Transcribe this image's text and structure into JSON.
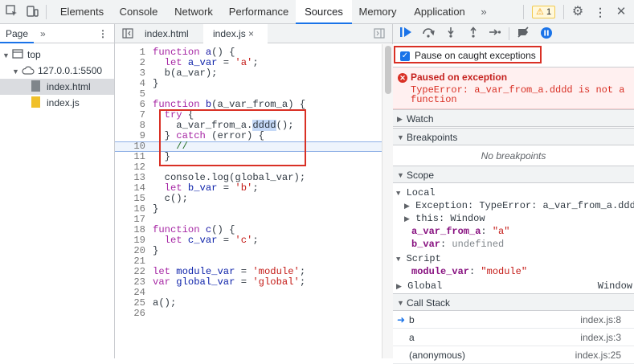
{
  "toolbar": {
    "tabs": [
      "Elements",
      "Console",
      "Network",
      "Performance",
      "Sources",
      "Memory",
      "Application"
    ],
    "more_tabs": "»",
    "warning_count": "1"
  },
  "navigator": {
    "tab": "Page",
    "more": "»",
    "tree": {
      "top": "top",
      "host": "127.0.0.1:5500",
      "files": [
        "index.html",
        "index.js"
      ]
    }
  },
  "editor": {
    "tabs": [
      "index.html",
      "index.js"
    ],
    "close": "×",
    "lines": [
      "1",
      "2",
      "3",
      "4",
      "5",
      "6",
      "7",
      "8",
      "9",
      "10",
      "11",
      "12",
      "13",
      "14",
      "15",
      "16",
      "17",
      "18",
      "19",
      "20",
      "21",
      "22",
      "23",
      "24",
      "25",
      "26"
    ],
    "code": {
      "l1a": "function ",
      "l1b": "a",
      "l1c": "() {",
      "l2a": "  let ",
      "l2b": "a_var",
      "l2c": " = ",
      "l2d": "'a'",
      "l2e": ";",
      "l3": "  b(a_var);",
      "l4": "}",
      "l6a": "function ",
      "l6b": "b",
      "l6c": "(a_var_from_a) {",
      "l7a": "  ",
      "l7b": "try",
      "l7c": " {",
      "l8a": "    a_var_from_a.",
      "l8b": "dddd",
      "l8c": "();",
      "l9a": "  } ",
      "l9b": "catch",
      "l9c": " (error) {",
      "l10": "    //",
      "l11": "  }",
      "l13": "  console.log(global_var);",
      "l14a": "  let ",
      "l14b": "b_var",
      "l14c": " = ",
      "l14d": "'b'",
      "l14e": ";",
      "l15": "  c();",
      "l16": "}",
      "l18a": "function ",
      "l18b": "c",
      "l18c": "() {",
      "l19a": "  let ",
      "l19b": "c_var",
      "l19c": " = ",
      "l19d": "'c'",
      "l19e": ";",
      "l20": "}",
      "l22a": "let ",
      "l22b": "module_var",
      "l22c": " = ",
      "l22d": "'module'",
      "l22e": ";",
      "l23a": "var ",
      "l23b": "global_var",
      "l23c": " = ",
      "l23d": "'global'",
      "l23e": ";",
      "l25": "a();"
    }
  },
  "debugger": {
    "pause_on_caught": "Pause on caught exceptions",
    "paused_title": "Paused on exception",
    "paused_message": "TypeError: a_var_from_a.dddd is not a function",
    "watch": "Watch",
    "breakpoints": "Breakpoints",
    "no_breakpoints": "No breakpoints",
    "scope": "Scope",
    "local": "Local",
    "exception_key": "Exception",
    "exception_val": ": TypeError: a_var_from_a.dddd",
    "this_key": "this",
    "this_val": ": Window",
    "a_var_from_a_key": "a_var_from_a",
    "a_var_from_a_val": "\"a\"",
    "b_var_key": "b_var",
    "b_var_val": "undefined",
    "script": "Script",
    "module_var_key": "module_var",
    "module_var_val": "\"module\"",
    "global": "Global",
    "global_val": "Window",
    "call_stack": "Call Stack",
    "frames": [
      {
        "name": "b",
        "loc": "index.js:8"
      },
      {
        "name": "a",
        "loc": "index.js:3"
      },
      {
        "name": "(anonymous)",
        "loc": "index.js:25"
      }
    ]
  },
  "colors": {
    "accent": "#1a73e8",
    "error": "#d93025"
  }
}
